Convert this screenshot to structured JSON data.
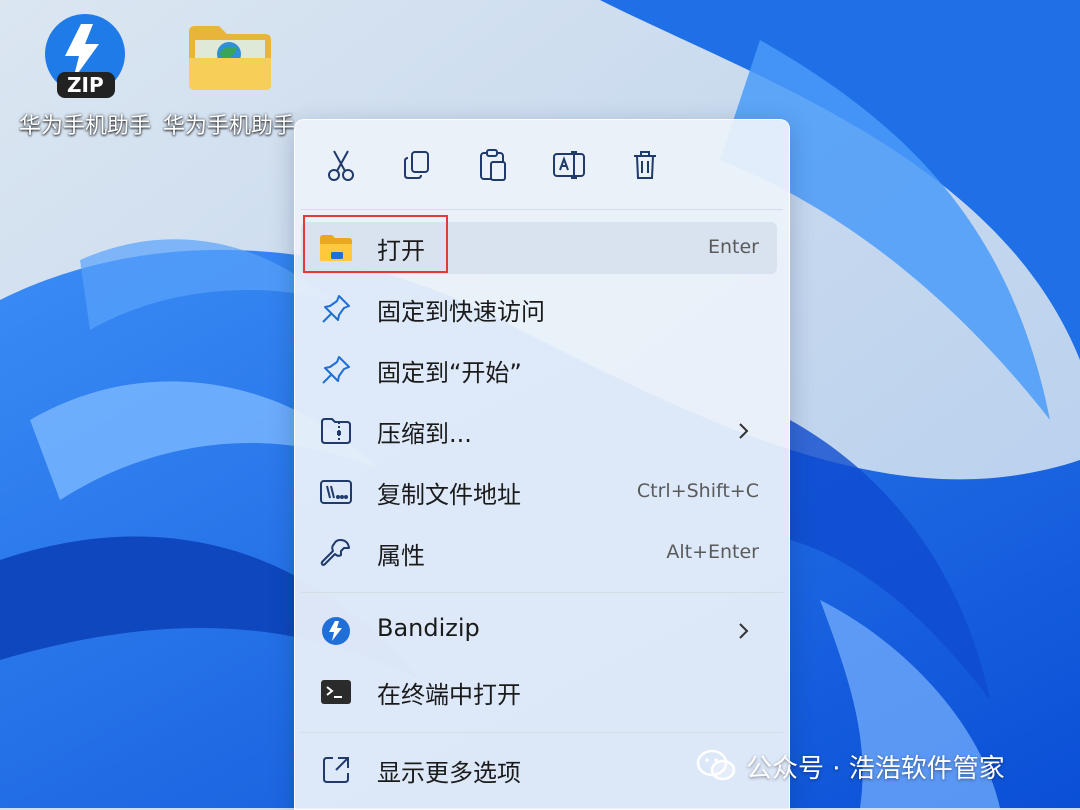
{
  "desktop": {
    "icons": [
      {
        "label": "华为手机助手",
        "icon": "zip-installer-icon",
        "badge": "ZIP"
      },
      {
        "label": "华为手机助手",
        "icon": "folder-icon"
      }
    ]
  },
  "context_menu": {
    "quick_actions": [
      {
        "name": "cut",
        "icon": "scissors-icon"
      },
      {
        "name": "copy",
        "icon": "copy-icon"
      },
      {
        "name": "paste",
        "icon": "clipboard-icon"
      },
      {
        "name": "rename",
        "icon": "rename-icon"
      },
      {
        "name": "delete",
        "icon": "trash-icon"
      }
    ],
    "items": [
      {
        "label": "打开",
        "shortcut": "Enter",
        "icon": "folder-open-icon",
        "highlighted": true
      },
      {
        "label": "固定到快速访问",
        "shortcut": "",
        "icon": "pin-icon"
      },
      {
        "label": "固定到“开始”",
        "shortcut": "",
        "icon": "pin-icon"
      },
      {
        "label": "压缩到...",
        "shortcut": "",
        "icon": "zip-folder-icon",
        "submenu": true
      },
      {
        "label": "复制文件地址",
        "shortcut": "Ctrl+Shift+C",
        "icon": "path-copy-icon"
      },
      {
        "label": "属性",
        "shortcut": "Alt+Enter",
        "icon": "wrench-icon"
      },
      {
        "label": "Bandizip",
        "shortcut": "",
        "icon": "bandizip-icon",
        "submenu": true
      },
      {
        "label": "在终端中打开",
        "shortcut": "",
        "icon": "terminal-icon"
      },
      {
        "label": "显示更多选项",
        "shortcut": "",
        "icon": "more-options-icon"
      }
    ]
  },
  "watermark": {
    "text": "公众号 · 浩浩软件管家",
    "icon": "wechat-icon"
  },
  "colors": {
    "accent": "#0067c0",
    "highlight_box": "#e53935",
    "wallpaper_blue": "#1a6fe8"
  }
}
